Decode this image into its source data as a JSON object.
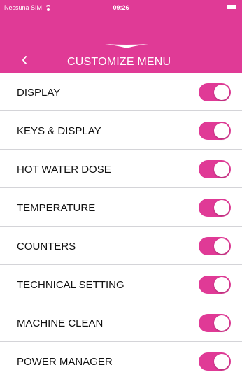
{
  "status_bar": {
    "carrier": "Nessuna SIM",
    "time": "09:26"
  },
  "header": {
    "back_icon": "chevron-left-icon",
    "title": "CUSTOMIZE MENU",
    "logo_icon": "brand-wing-logo"
  },
  "menu": {
    "items": [
      {
        "label": "DISPLAY",
        "enabled": true
      },
      {
        "label": "KEYS & DISPLAY",
        "enabled": true
      },
      {
        "label": "HOT WATER DOSE",
        "enabled": true
      },
      {
        "label": "TEMPERATURE",
        "enabled": true
      },
      {
        "label": "COUNTERS",
        "enabled": true
      },
      {
        "label": "TECHNICAL SETTING",
        "enabled": true
      },
      {
        "label": "MACHINE CLEAN",
        "enabled": true
      },
      {
        "label": "POWER MANAGER",
        "enabled": true
      }
    ]
  },
  "colors": {
    "accent": "#e03a96",
    "background": "#ececf0",
    "row_background": "#ffffff",
    "text": "#111111"
  }
}
